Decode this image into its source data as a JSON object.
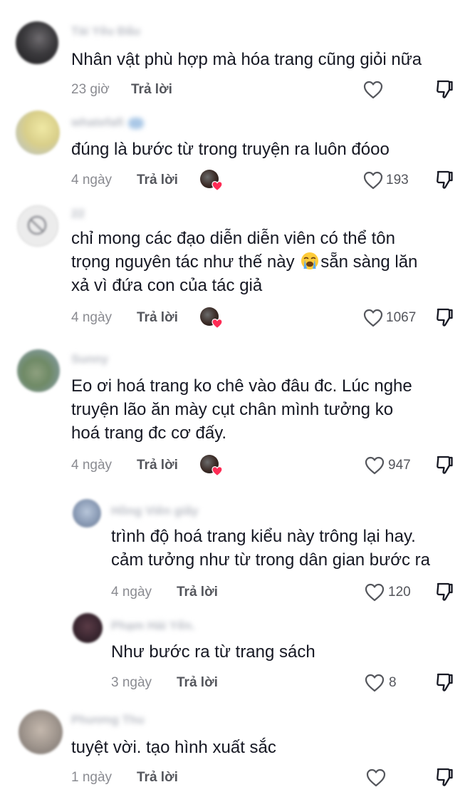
{
  "comments": [
    {
      "username": "Tài Yêu Đấu",
      "lines": [
        "Nhân vật phù hợp mà hóa trang cũng giỏi nữa"
      ],
      "time": "23 giờ",
      "reply_label": "Trả lời",
      "likes": "",
      "avatar_color": "#3b3a3d"
    },
    {
      "username": "whatefafi",
      "lines": [
        "đúng là bước từ trong truyện ra luôn đóoo"
      ],
      "time": "4 ngày",
      "reply_label": "Trả lời",
      "likes": "193",
      "avatar_color": "#d9cf8a"
    },
    {
      "username": "22",
      "lines": [
        "chỉ mong các đạo diễn diễn viên có thể tôn",
        "trọng nguyên tác như thế này ",
        "xả vì đứa con của tác giả"
      ],
      "line2_after_emoji": "sẵn sàng lăn",
      "time": "4 ngày",
      "reply_label": "Trả lời",
      "likes": "1067",
      "avatar_color": "#e8e8e8"
    },
    {
      "username": "Sunny",
      "lines": [
        "Eo ơi hoá trang ko chê vào đâu đc. Lúc nghe",
        "truyện lão ăn mày cụt chân mình tưởng ko",
        "hoá trang đc cơ đấy."
      ],
      "time": "4 ngày",
      "reply_label": "Trả lời",
      "likes": "947",
      "avatar_color": "#6f8a66"
    },
    {
      "username": "Hồng Viên giấy",
      "lines": [
        "trình độ hoá trang kiểu này trông lại hay.",
        "cảm tưởng như từ trong dân gian bước ra"
      ],
      "time": "4 ngày",
      "reply_label": "Trả lời",
      "likes": "120",
      "avatar_color": "#8a9bb5"
    },
    {
      "username": "Phạm Hải Yến.",
      "lines": [
        "Như bước ra từ trang sách"
      ],
      "time": "3 ngày",
      "reply_label": "Trả lời",
      "likes": "8",
      "avatar_color": "#3a2630"
    },
    {
      "username": "Phương Thu",
      "lines": [
        "tuyệt vời. tạo hình xuất sắc"
      ],
      "time": "1 ngày",
      "reply_label": "Trả lời",
      "likes": "",
      "avatar_color": "#a0968e"
    }
  ],
  "icons": {
    "like": "heart-outline-icon",
    "dislike": "thumbs-down-outline-icon",
    "emoji": "loudly-crying-face-emoji",
    "creator_liked": "creator-liked-badge"
  },
  "colors": {
    "text": "#161823",
    "meta": "#8a8b91",
    "reply": "#54565c",
    "badge_heart": "#fe2c55"
  }
}
